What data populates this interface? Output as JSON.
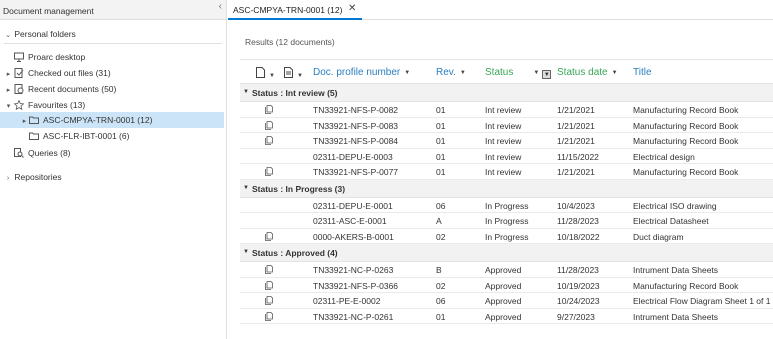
{
  "left_panel": {
    "title": "Document management",
    "collapse_icon": "chevron-left-icon",
    "tree": {
      "personal_folders": "Personal folders",
      "proarc_desktop": "Proarc desktop",
      "checked_out": "Checked out files (31)",
      "recent": "Recent documents (50)",
      "favourites": "Favourites (13)",
      "fav1": "ASC-CMPYA-TRN-0001 (12)",
      "fav2": "ASC-FLR-IBT-0001 (6)",
      "queries": "Queries (8)",
      "repositories": "Repositories"
    }
  },
  "tab": {
    "label": "ASC-CMPYA-TRN-0001 (12)",
    "close": "✕"
  },
  "results_label": "Results (12 documents)",
  "columns": {
    "doc_profile": "Doc. profile number",
    "rev": "Rev.",
    "status": "Status",
    "status_date": "Status date",
    "title": "Title"
  },
  "groups": [
    {
      "label": "Status : Int review (5)",
      "rows": [
        {
          "icon": true,
          "doc": "TN33921-NFS-P-0082",
          "rev": "01",
          "status": "Int review",
          "date": "1/21/2021",
          "title": "Manufacturing Record Book"
        },
        {
          "icon": true,
          "doc": "TN33921-NFS-P-0083",
          "rev": "01",
          "status": "Int review",
          "date": "1/21/2021",
          "title": "Manufacturing Record Book"
        },
        {
          "icon": true,
          "doc": "TN33921-NFS-P-0084",
          "rev": "01",
          "status": "Int review",
          "date": "1/21/2021",
          "title": "Manufacturing Record Book"
        },
        {
          "icon": false,
          "doc": "02311-DEPU-E-0003",
          "rev": "01",
          "status": "Int review",
          "date": "11/15/2022",
          "title": "Electrical design"
        },
        {
          "icon": true,
          "doc": "TN33921-NFS-P-0077",
          "rev": "01",
          "status": "Int review",
          "date": "1/21/2021",
          "title": "Manufacturing Record Book"
        }
      ]
    },
    {
      "label": "Status : In Progress (3)",
      "rows": [
        {
          "icon": false,
          "doc": "02311-DEPU-E-0001",
          "rev": "06",
          "status": "In Progress",
          "date": "10/4/2023",
          "title": "Electrical ISO drawing"
        },
        {
          "icon": false,
          "doc": "02311-ASC-E-0001",
          "rev": "A",
          "status": "In Progress",
          "date": "11/28/2023",
          "title": "Electrical Datasheet"
        },
        {
          "icon": true,
          "doc": "0000-AKERS-B-0001",
          "rev": "02",
          "status": "In Progress",
          "date": "10/18/2022",
          "title": "Duct diagram"
        }
      ]
    },
    {
      "label": "Status : Approved (4)",
      "rows": [
        {
          "icon": true,
          "doc": "TN33921-NC-P-0263",
          "rev": "B",
          "status": "Approved",
          "date": "11/28/2023",
          "title": "Intrument Data Sheets"
        },
        {
          "icon": true,
          "doc": "TN33921-NFS-P-0366",
          "rev": "02",
          "status": "Approved",
          "date": "10/19/2023",
          "title": "Manufacturing Record Book"
        },
        {
          "icon": true,
          "doc": "02311-PE-E-0002",
          "rev": "06",
          "status": "Approved",
          "date": "10/24/2023",
          "title": "Electrical Flow Diagram Sheet 1 of 1"
        },
        {
          "icon": true,
          "doc": "TN33921-NC-P-0261",
          "rev": "01",
          "status": "Approved",
          "date": "9/27/2023",
          "title": "Intrument Data Sheets"
        }
      ]
    }
  ],
  "colors": {
    "accent": "#2a7fc0",
    "status_header": "#3aa65a",
    "selected": "#cce4f7"
  }
}
